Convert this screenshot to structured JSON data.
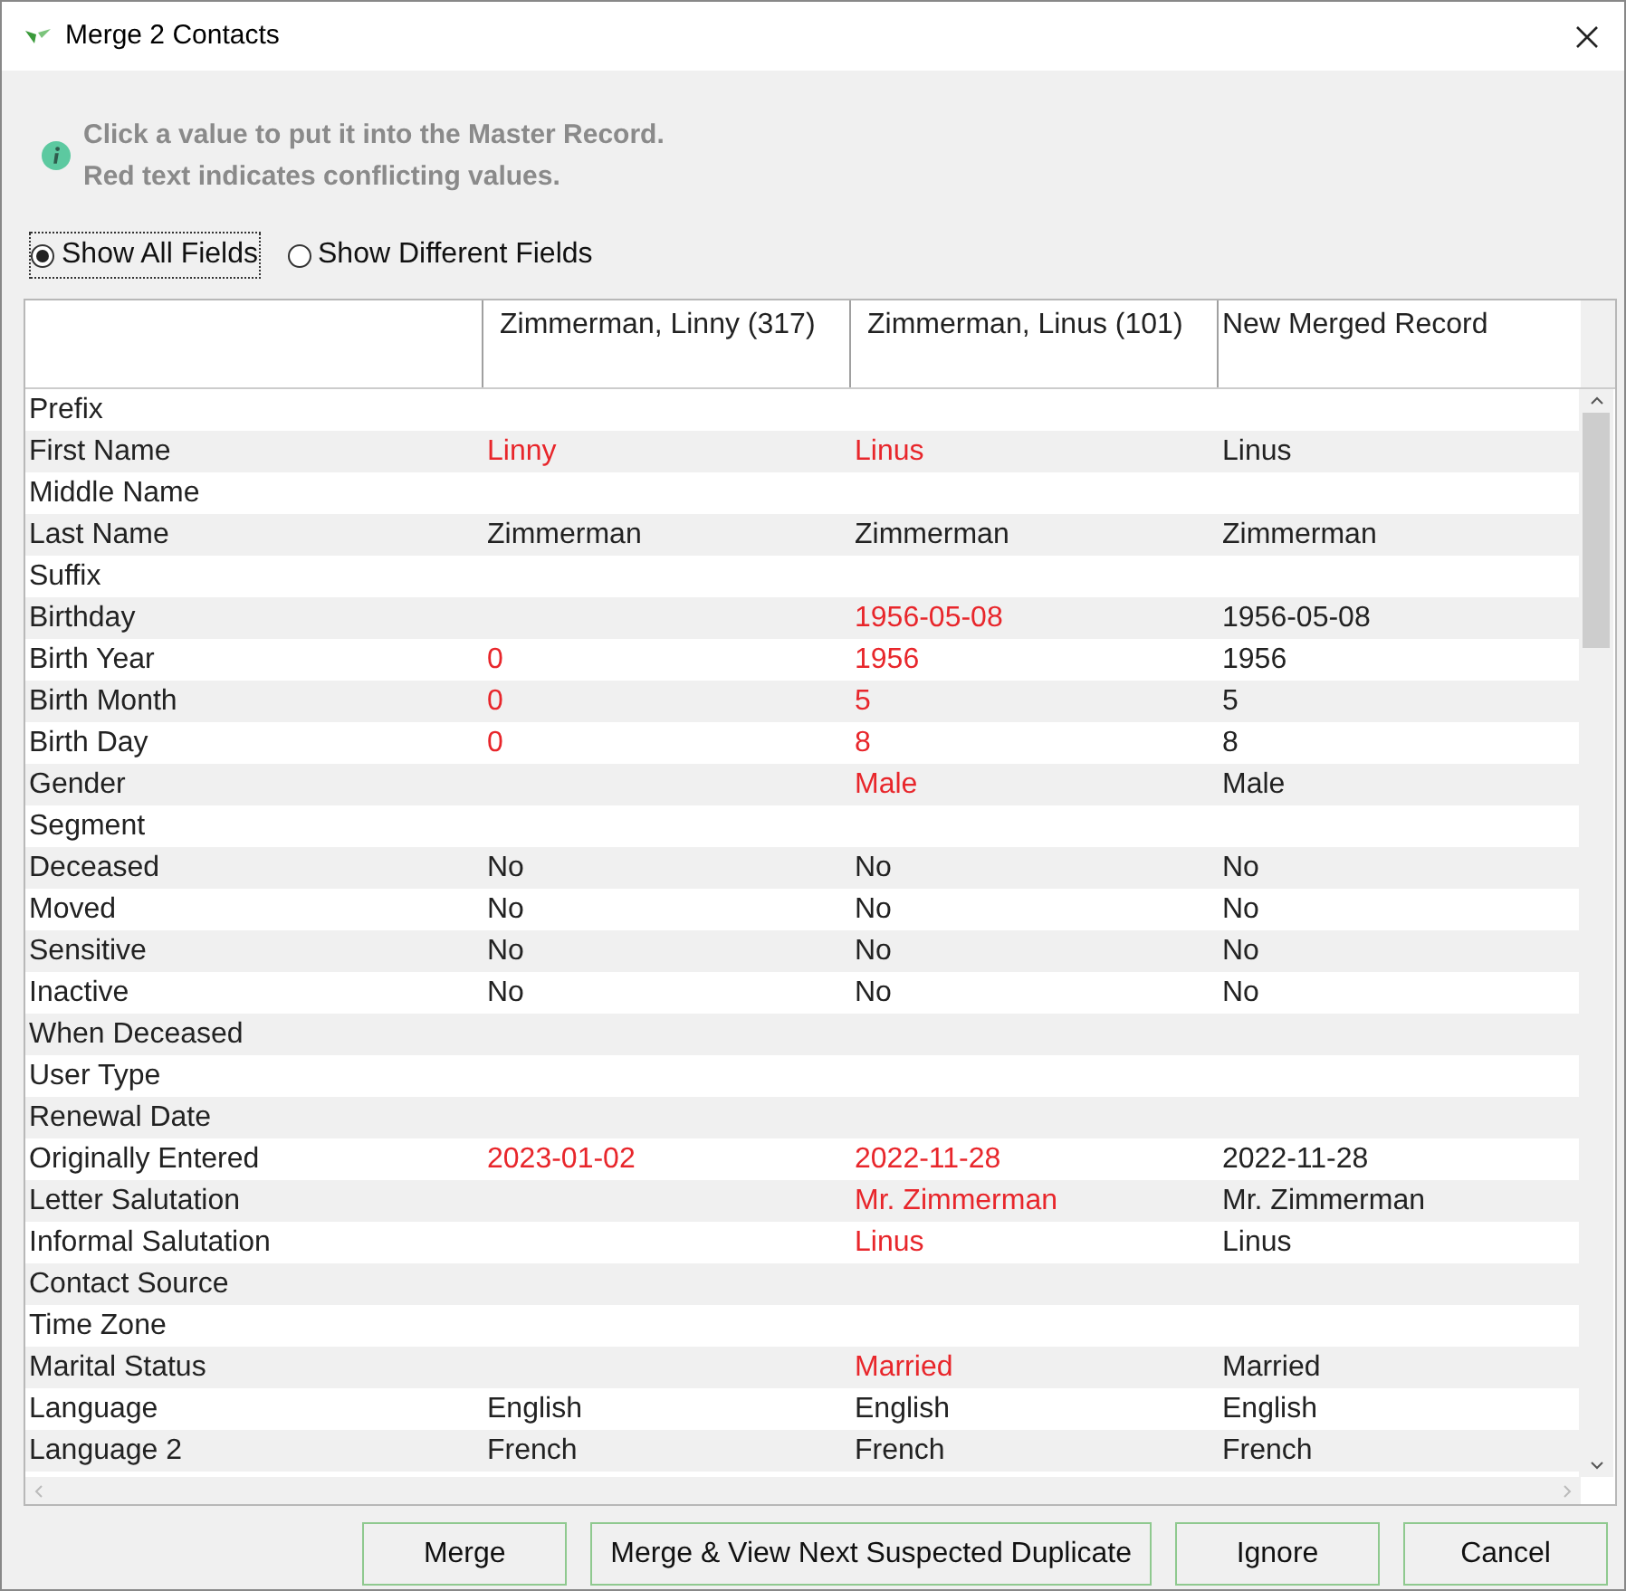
{
  "window": {
    "title": "Merge 2 Contacts"
  },
  "info": {
    "lines": [
      "Click a value to put it into the Master Record.",
      "Red text indicates conflicting values."
    ]
  },
  "view_options": [
    {
      "label": "Show All Fields",
      "selected": true
    },
    {
      "label": "Show Different Fields",
      "selected": false
    }
  ],
  "table": {
    "columns": [
      "Zimmerman, Linny (317)",
      "Zimmerman, Linus (101)",
      "New Merged Record"
    ],
    "rows": [
      {
        "field": "Prefix"
      },
      {
        "field": "First Name",
        "contact_1": {
          "value": "Linny",
          "conflicting": true
        },
        "contact_2": {
          "value": "Linus",
          "conflicting": true
        },
        "merged": "Linus"
      },
      {
        "field": "Middle Name"
      },
      {
        "field": "Last Name",
        "contact_1": {
          "value": "Zimmerman",
          "conflicting": false
        },
        "contact_2": {
          "value": "Zimmerman",
          "conflicting": false
        },
        "merged": "Zimmerman"
      },
      {
        "field": "Suffix"
      },
      {
        "field": "Birthday",
        "contact_2": {
          "value": "1956-05-08",
          "conflicting": true
        },
        "merged": "1956-05-08"
      },
      {
        "field": "Birth Year",
        "contact_1": {
          "value": "0",
          "conflicting": true
        },
        "contact_2": {
          "value": "1956",
          "conflicting": true
        },
        "merged": "1956"
      },
      {
        "field": "Birth Month",
        "contact_1": {
          "value": "0",
          "conflicting": true
        },
        "contact_2": {
          "value": "5",
          "conflicting": true
        },
        "merged": "5"
      },
      {
        "field": "Birth Day",
        "contact_1": {
          "value": "0",
          "conflicting": true
        },
        "contact_2": {
          "value": "8",
          "conflicting": true
        },
        "merged": "8"
      },
      {
        "field": "Gender",
        "contact_2": {
          "value": "Male",
          "conflicting": true
        },
        "merged": "Male"
      },
      {
        "field": "Segment"
      },
      {
        "field": "Deceased",
        "contact_1": {
          "value": "No",
          "conflicting": false
        },
        "contact_2": {
          "value": "No",
          "conflicting": false
        },
        "merged": "No"
      },
      {
        "field": "Moved",
        "contact_1": {
          "value": "No",
          "conflicting": false
        },
        "contact_2": {
          "value": "No",
          "conflicting": false
        },
        "merged": "No"
      },
      {
        "field": "Sensitive",
        "contact_1": {
          "value": "No",
          "conflicting": false
        },
        "contact_2": {
          "value": "No",
          "conflicting": false
        },
        "merged": "No"
      },
      {
        "field": "Inactive",
        "contact_1": {
          "value": "No",
          "conflicting": false
        },
        "contact_2": {
          "value": "No",
          "conflicting": false
        },
        "merged": "No"
      },
      {
        "field": "When Deceased"
      },
      {
        "field": "User Type"
      },
      {
        "field": "Renewal Date"
      },
      {
        "field": "Originally Entered",
        "contact_1": {
          "value": "2023-01-02",
          "conflicting": true
        },
        "contact_2": {
          "value": "2022-11-28",
          "conflicting": true
        },
        "merged": "2022-11-28"
      },
      {
        "field": "Letter Salutation",
        "contact_2": {
          "value": "Mr. Zimmerman",
          "conflicting": true
        },
        "merged": "Mr. Zimmerman"
      },
      {
        "field": "Informal Salutation",
        "contact_2": {
          "value": "Linus",
          "conflicting": true
        },
        "merged": "Linus"
      },
      {
        "field": "Contact Source"
      },
      {
        "field": "Time Zone"
      },
      {
        "field": "Marital Status",
        "contact_2": {
          "value": "Married",
          "conflicting": true
        },
        "merged": "Married"
      },
      {
        "field": "Language",
        "contact_1": {
          "value": "English",
          "conflicting": false
        },
        "contact_2": {
          "value": "English",
          "conflicting": false
        },
        "merged": "English"
      },
      {
        "field": "Language 2",
        "contact_1": {
          "value": "French",
          "conflicting": false
        },
        "contact_2": {
          "value": "French",
          "conflicting": false
        },
        "merged": "French"
      }
    ]
  },
  "buttons": [
    "Merge",
    "Merge & View Next Suspected Duplicate",
    "Ignore",
    "Cancel"
  ]
}
